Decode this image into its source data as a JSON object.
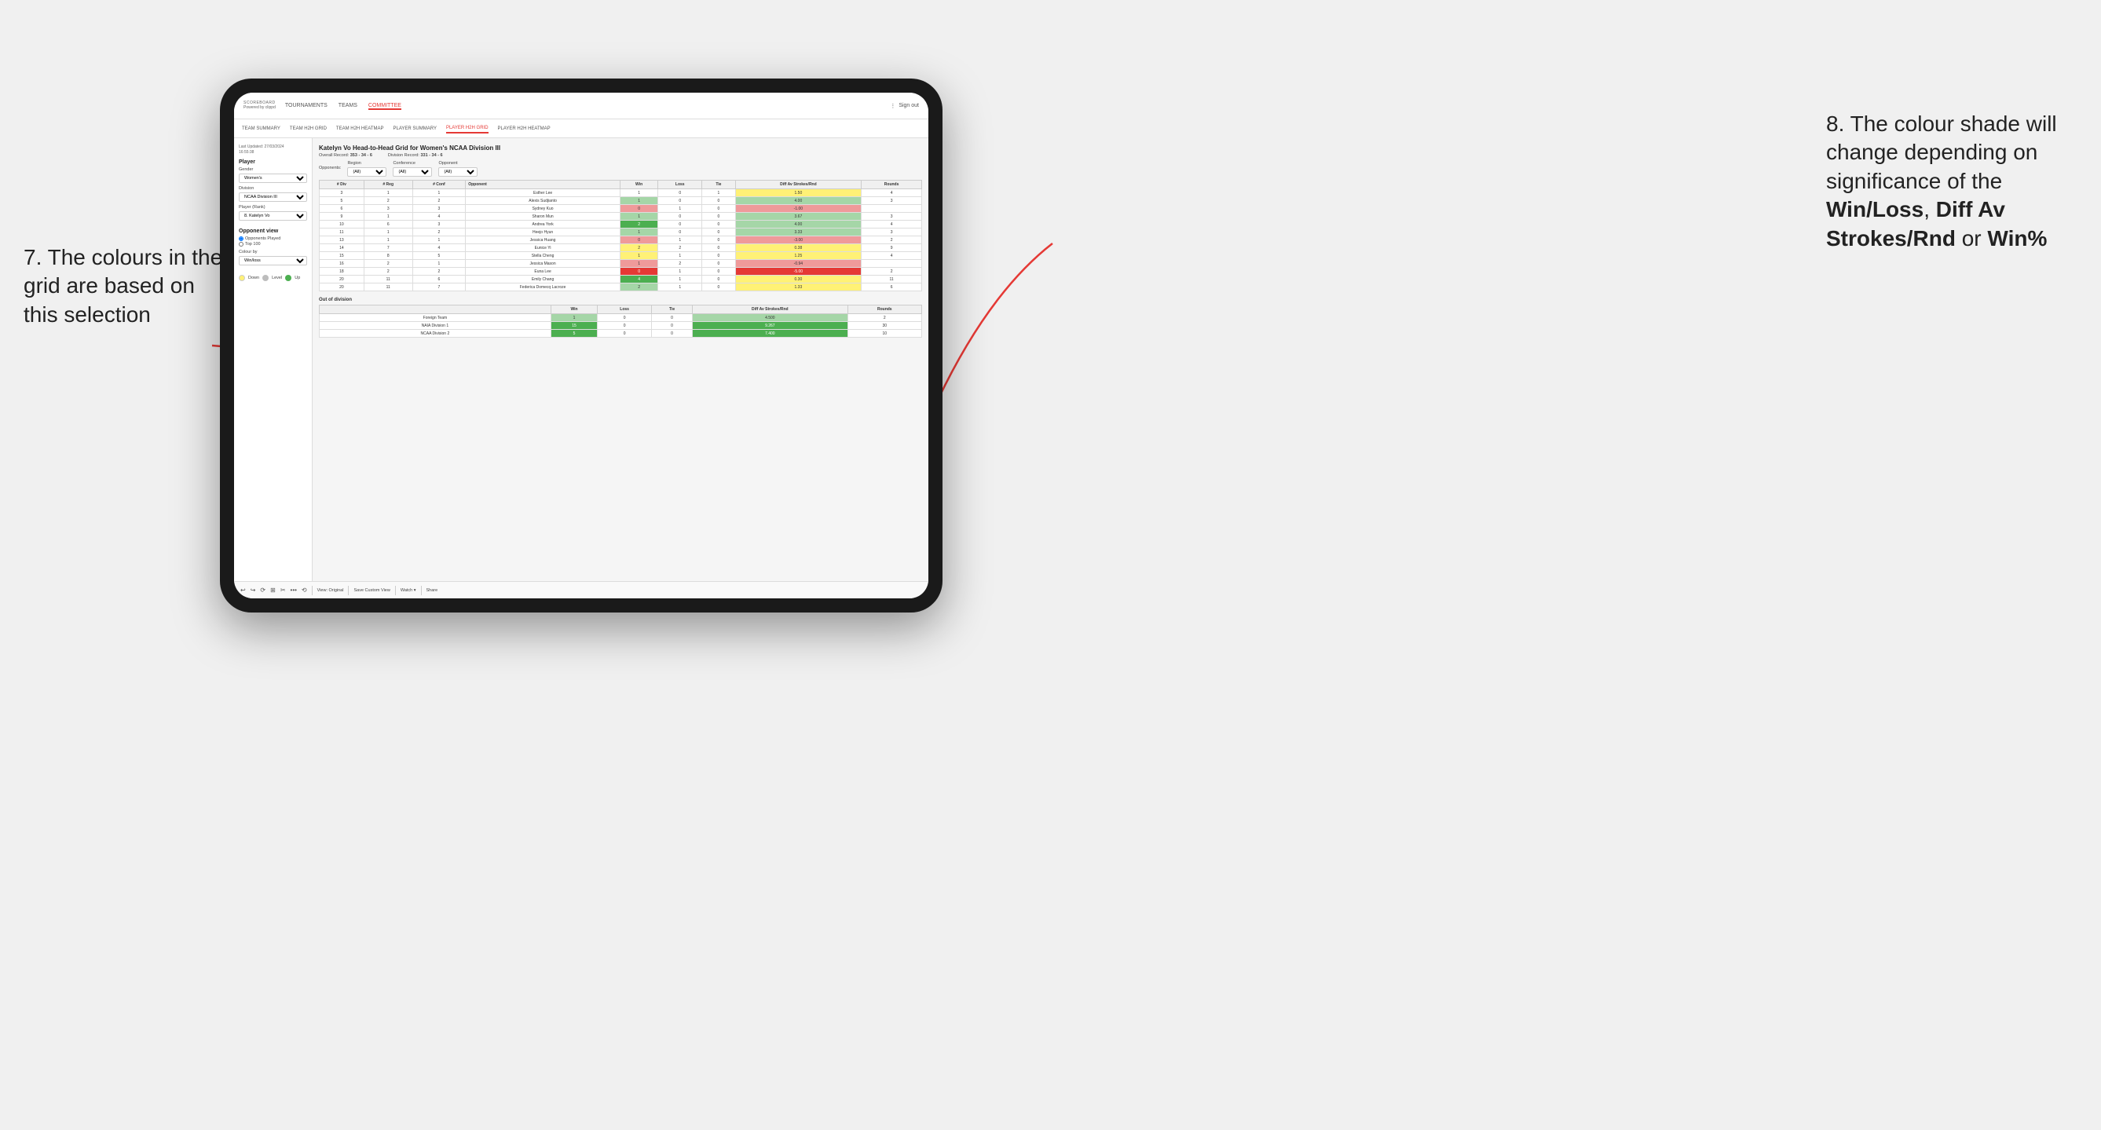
{
  "annotations": {
    "left_title": "7. The colours in the grid are based on this selection",
    "right_title": "8. The colour shade will change depending on significance of the ",
    "right_bold1": "Win/Loss",
    "right_comma": ", ",
    "right_bold2": "Diff Av Strokes/Rnd",
    "right_or": " or ",
    "right_bold3": "Win%"
  },
  "nav": {
    "logo": "SCOREBOARD",
    "logo_sub": "Powered by clippd",
    "links": [
      "TOURNAMENTS",
      "TEAMS",
      "COMMITTEE"
    ],
    "right_icon": "⋮",
    "sign_out": "Sign out"
  },
  "subnav": {
    "links": [
      "TEAM SUMMARY",
      "TEAM H2H GRID",
      "TEAM H2H HEATMAP",
      "PLAYER SUMMARY",
      "PLAYER H2H GRID",
      "PLAYER H2H HEATMAP"
    ]
  },
  "sidebar": {
    "last_updated_label": "Last Updated: 27/03/2024",
    "last_updated_time": "16:55:38",
    "section_player": "Player",
    "gender_label": "Gender",
    "gender_value": "Women's",
    "division_label": "Division",
    "division_value": "NCAA Division III",
    "player_rank_label": "Player (Rank)",
    "player_rank_value": "8. Katelyn Vo",
    "opponent_view_label": "Opponent view",
    "opponent_played_label": "Opponents Played",
    "top100_label": "Top 100",
    "colour_by_label": "Colour by",
    "colour_by_value": "Win/loss",
    "legend_down": "Down",
    "legend_level": "Level",
    "legend_up": "Up"
  },
  "grid": {
    "title": "Katelyn Vo Head-to-Head Grid for Women's NCAA Division III",
    "overall_record_label": "Overall Record:",
    "overall_record_value": "353 - 34 - 6",
    "division_record_label": "Division Record:",
    "division_record_value": "331 - 34 - 6",
    "opponents_label": "Opponents:",
    "region_label": "Region",
    "region_value": "(All)",
    "conference_label": "Conference",
    "conference_value": "(All)",
    "opponent_label": "Opponent",
    "opponent_value": "(All)",
    "columns": [
      "# Div",
      "# Reg",
      "# Conf",
      "Opponent",
      "Win",
      "Loss",
      "Tie",
      "Diff Av Strokes/Rnd",
      "Rounds"
    ],
    "rows": [
      {
        "div": 3,
        "reg": 1,
        "conf": 1,
        "opponent": "Esther Lee",
        "win": 1,
        "loss": 0,
        "tie": 1,
        "diff": 1.5,
        "rounds": 4,
        "win_color": "white",
        "diff_color": "yellow"
      },
      {
        "div": 5,
        "reg": 2,
        "conf": 2,
        "opponent": "Alexis Sudjianto",
        "win": 1,
        "loss": 0,
        "tie": 0,
        "diff": 4.0,
        "rounds": 3,
        "win_color": "green-light",
        "diff_color": "green-light"
      },
      {
        "div": 6,
        "reg": 3,
        "conf": 3,
        "opponent": "Sydney Kuo",
        "win": 0,
        "loss": 1,
        "tie": 0,
        "diff": -1.0,
        "rounds": "",
        "win_color": "red-light",
        "diff_color": "red-light"
      },
      {
        "div": 9,
        "reg": 1,
        "conf": 4,
        "opponent": "Sharon Mun",
        "win": 1,
        "loss": 0,
        "tie": 0,
        "diff": 3.67,
        "rounds": 3,
        "win_color": "green-light",
        "diff_color": "green-light"
      },
      {
        "div": 10,
        "reg": 6,
        "conf": 3,
        "opponent": "Andrea York",
        "win": 2,
        "loss": 0,
        "tie": 0,
        "diff": 4.0,
        "rounds": 4,
        "win_color": "green-dark",
        "diff_color": "green-light"
      },
      {
        "div": 11,
        "reg": 1,
        "conf": 2,
        "opponent": "Heejo Hyun",
        "win": 1,
        "loss": 0,
        "tie": 0,
        "diff": 3.33,
        "rounds": 3,
        "win_color": "green-light",
        "diff_color": "green-light"
      },
      {
        "div": 13,
        "reg": 1,
        "conf": 1,
        "opponent": "Jessica Huang",
        "win": 0,
        "loss": 1,
        "tie": 0,
        "diff": -3.0,
        "rounds": 2,
        "win_color": "red-light",
        "diff_color": "red-light"
      },
      {
        "div": 14,
        "reg": 7,
        "conf": 4,
        "opponent": "Eunice Yi",
        "win": 2,
        "loss": 2,
        "tie": 0,
        "diff": 0.38,
        "rounds": 9,
        "win_color": "yellow",
        "diff_color": "yellow"
      },
      {
        "div": 15,
        "reg": 8,
        "conf": 5,
        "opponent": "Stella Cheng",
        "win": 1,
        "loss": 1,
        "tie": 0,
        "diff": 1.25,
        "rounds": 4,
        "win_color": "yellow",
        "diff_color": "yellow"
      },
      {
        "div": 16,
        "reg": 2,
        "conf": 1,
        "opponent": "Jessica Mason",
        "win": 1,
        "loss": 2,
        "tie": 0,
        "diff": -0.94,
        "rounds": "",
        "win_color": "red-light",
        "diff_color": "red-light"
      },
      {
        "div": 18,
        "reg": 2,
        "conf": 2,
        "opponent": "Euna Lee",
        "win": 0,
        "loss": 1,
        "tie": 0,
        "diff": -5.0,
        "rounds": 2,
        "win_color": "red-dark",
        "diff_color": "red-dark"
      },
      {
        "div": 20,
        "reg": 11,
        "conf": 6,
        "opponent": "Emily Chang",
        "win": 4,
        "loss": 1,
        "tie": 0,
        "diff": 0.3,
        "rounds": 11,
        "win_color": "green-dark",
        "diff_color": "yellow"
      },
      {
        "div": 20,
        "reg": 11,
        "conf": 7,
        "opponent": "Federica Domecq Lacroze",
        "win": 2,
        "loss": 1,
        "tie": 0,
        "diff": 1.33,
        "rounds": 6,
        "win_color": "green-light",
        "diff_color": "yellow"
      }
    ],
    "out_of_division_label": "Out of division",
    "out_of_division_rows": [
      {
        "opponent": "Foreign Team",
        "win": 1,
        "loss": 0,
        "tie": 0,
        "diff": 4.5,
        "rounds": 2,
        "win_color": "green-light",
        "diff_color": "green-light"
      },
      {
        "opponent": "NAIA Division 1",
        "win": 15,
        "loss": 0,
        "tie": 0,
        "diff": 9.267,
        "rounds": 30,
        "win_color": "green-dark",
        "diff_color": "green-dark"
      },
      {
        "opponent": "NCAA Division 2",
        "win": 5,
        "loss": 0,
        "tie": 0,
        "diff": 7.4,
        "rounds": 10,
        "win_color": "green-dark",
        "diff_color": "green-dark"
      }
    ]
  },
  "toolbar": {
    "icons": [
      "↩",
      "↪",
      "⟳",
      "⊞",
      "✂",
      "·",
      "⟲",
      "·"
    ],
    "view_original": "View: Original",
    "save_custom": "Save Custom View",
    "watch": "Watch ▾",
    "share": "Share"
  }
}
